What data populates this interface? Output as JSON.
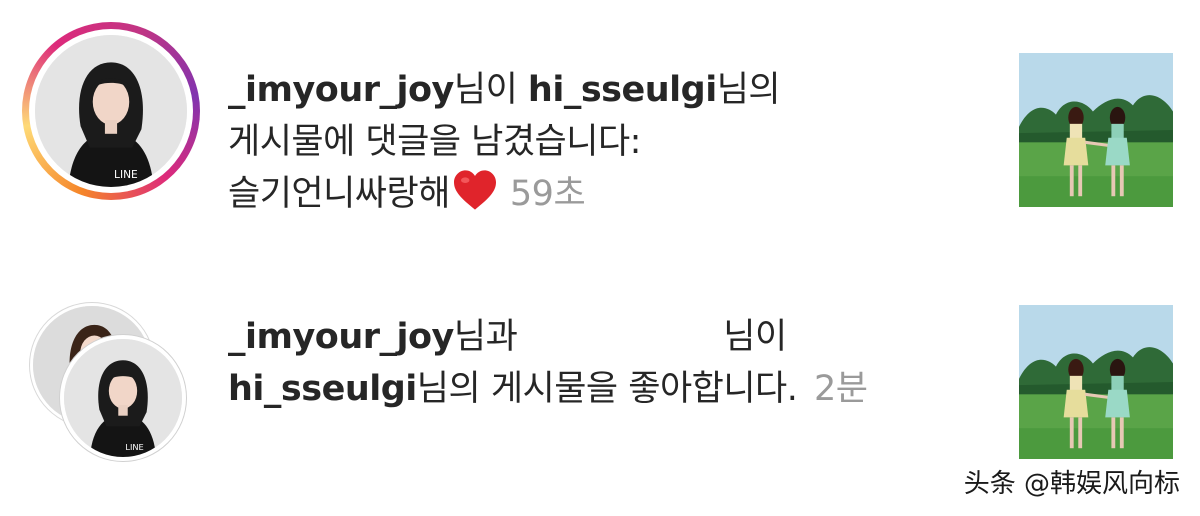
{
  "notifications": [
    {
      "username": "_imyour_joy",
      "text_after_username": "님이",
      "target_username": "hi_sseulgi",
      "text_after_target": "님의",
      "line2": "게시물에 댓글을 남겼습니다:",
      "comment": "슬기언니싸랑해",
      "emoji": "heart-emoji",
      "timestamp": "59초"
    },
    {
      "username": "_imyour_joy",
      "text_after_username": "님과",
      "text_after_hidden": "님이",
      "target_username": "hi_sseulgi",
      "line2_rest": "님의 게시물을 좋아합니다.",
      "timestamp": "2분"
    }
  ],
  "watermark": "头条 @韩娱风向标",
  "colors": {
    "text": "#262626",
    "timestamp": "#9a9a9a",
    "heart": "#e0242b",
    "story_ring_start": "#f58529",
    "story_ring_end": "#dd2a7b"
  }
}
